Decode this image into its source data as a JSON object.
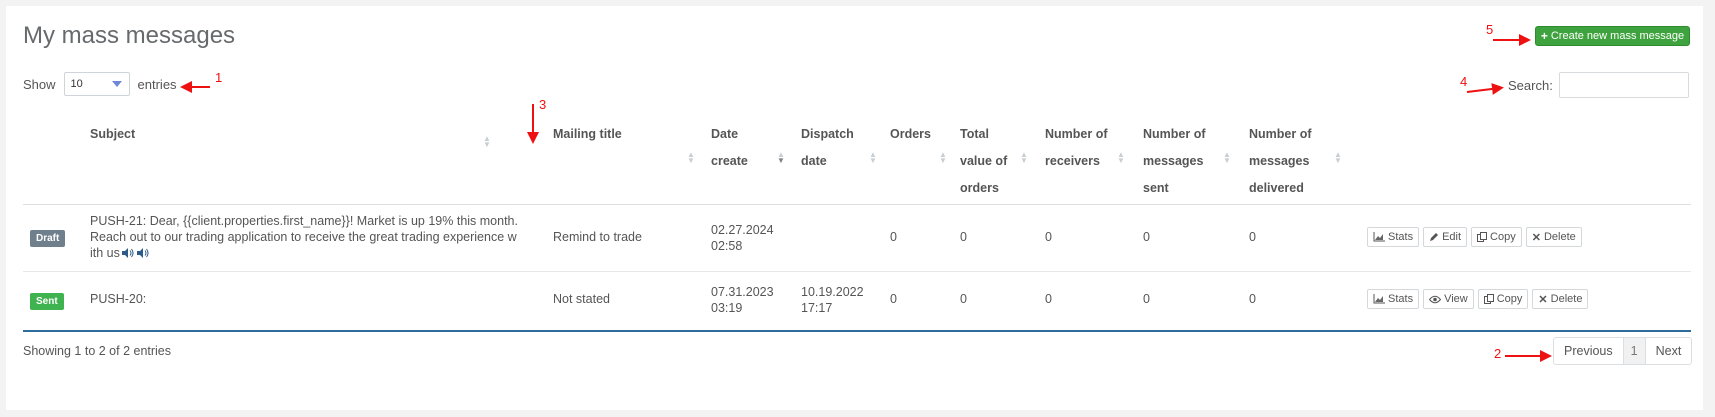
{
  "page": {
    "title": "My mass messages",
    "create_button": "Create new mass message"
  },
  "length": {
    "show_label": "Show",
    "selected": "10",
    "entries_label": "entries"
  },
  "search": {
    "label": "Search:",
    "value": ""
  },
  "table": {
    "columns": [
      {
        "line1": "Subject",
        "line2": "",
        "line3": ""
      },
      {
        "line1": "Mailing title",
        "line2": "",
        "line3": ""
      },
      {
        "line1": "Date",
        "line2": "create",
        "line3": ""
      },
      {
        "line1": "Dispatch",
        "line2": "date",
        "line3": ""
      },
      {
        "line1": "Orders",
        "line2": "",
        "line3": ""
      },
      {
        "line1": "Total",
        "line2": "value of",
        "line3": "orders"
      },
      {
        "line1": "Number of",
        "line2": "receivers",
        "line3": ""
      },
      {
        "line1": "Number of",
        "line2": "messages",
        "line3": "sent"
      },
      {
        "line1": "Number of",
        "line2": "messages",
        "line3": "delivered"
      }
    ],
    "rows": [
      {
        "status": "Draft",
        "subject_line1": "PUSH-21: Dear, {{client.properties.first_name}}! Market is up 19% this month.",
        "subject_line2": "Reach out to our trading application to receive the great trading experience w",
        "subject_line3": "ith us",
        "mailing_title": "Remind to trade",
        "date_create_1": "02.27.2024",
        "date_create_2": "02:58",
        "dispatch_1": "",
        "dispatch_2": "",
        "orders": "0",
        "total_value": "0",
        "receivers": "0",
        "sent": "0",
        "delivered": "0",
        "actions": [
          "Stats",
          "Edit",
          "Copy",
          "Delete"
        ]
      },
      {
        "status": "Sent",
        "subject_line1": "PUSH-20:",
        "subject_line2": "",
        "subject_line3": "",
        "mailing_title": "Not stated",
        "date_create_1": "07.31.2023",
        "date_create_2": "03:19",
        "dispatch_1": "10.19.2022",
        "dispatch_2": "17:17",
        "orders": "0",
        "total_value": "0",
        "receivers": "0",
        "sent": "0",
        "delivered": "0",
        "actions": [
          "Stats",
          "View",
          "Copy",
          "Delete"
        ]
      }
    ]
  },
  "footer": {
    "info": "Showing 1 to 2 of 2 entries",
    "previous": "Previous",
    "page": "1",
    "next": "Next"
  },
  "annotations": [
    "1",
    "2",
    "3",
    "4",
    "5"
  ],
  "colors": {
    "create_button": "#3ea33e",
    "draft_badge": "#6f808c",
    "sent_badge": "#3fb34f",
    "annotation": "#e11111",
    "table_bottom_border": "#2e6c9c"
  }
}
